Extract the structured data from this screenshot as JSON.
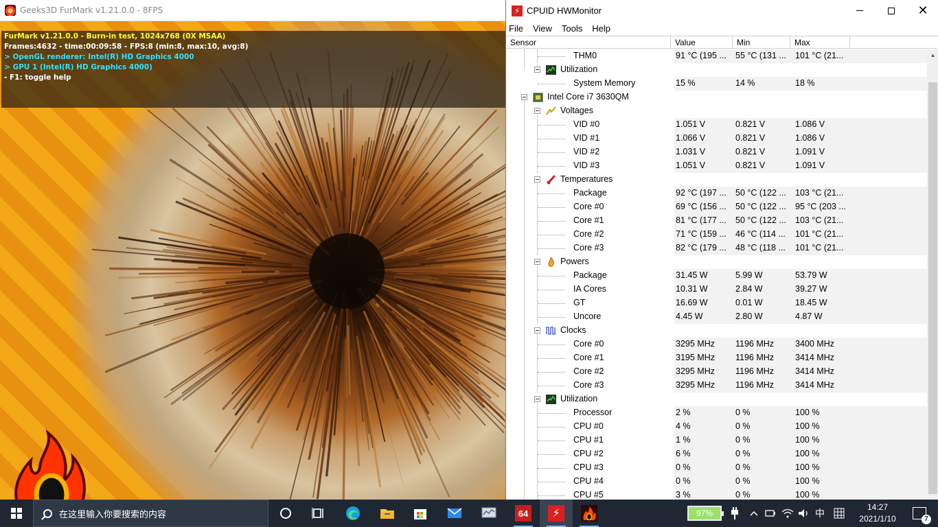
{
  "furmark": {
    "title": "Geeks3D FurMark v1.21.0.0 - 8FPS",
    "info_lines": [
      "FurMark v1.21.0.0 - Burn-in test, 1024x768 (0X MSAA)",
      "Frames:4632 - time:00:09:58 - FPS:8 (min:8, max:10, avg:8)",
      "> OpenGL renderer: Intel(R) HD Graphics 4000",
      "> GPU 1 (Intel(R) HD Graphics 4000)",
      "- F1: toggle help"
    ]
  },
  "hwmonitor": {
    "title": "CPUID HWMonitor",
    "menu": [
      "File",
      "View",
      "Tools",
      "Help"
    ],
    "columns": [
      "Sensor",
      "Value",
      "Min",
      "Max"
    ],
    "rows": [
      {
        "kind": "sensor",
        "name": "THM0",
        "value": "91 °C  (195 ...",
        "min": "55 °C  (131 ...",
        "max": "101 °C  (21..."
      },
      {
        "kind": "group",
        "name": "Utilization",
        "icon": "utilization-icon"
      },
      {
        "kind": "sensor",
        "name": "System Memory",
        "value": "15 %",
        "min": "14 %",
        "max": "18 %"
      },
      {
        "kind": "device",
        "name": "Intel Core i7 3630QM",
        "icon": "cpu-chip-icon"
      },
      {
        "kind": "group",
        "name": "Voltages",
        "icon": "voltage-icon"
      },
      {
        "kind": "sensor",
        "name": "VID #0",
        "value": "1.051 V",
        "min": "0.821 V",
        "max": "1.086 V"
      },
      {
        "kind": "sensor",
        "name": "VID #1",
        "value": "1.066 V",
        "min": "0.821 V",
        "max": "1.086 V"
      },
      {
        "kind": "sensor",
        "name": "VID #2",
        "value": "1.031 V",
        "min": "0.821 V",
        "max": "1.091 V"
      },
      {
        "kind": "sensor",
        "name": "VID #3",
        "value": "1.051 V",
        "min": "0.821 V",
        "max": "1.091 V"
      },
      {
        "kind": "group",
        "name": "Temperatures",
        "icon": "thermometer-icon"
      },
      {
        "kind": "sensor",
        "name": "Package",
        "value": "92 °C  (197 ...",
        "min": "50 °C  (122 ...",
        "max": "103 °C  (21..."
      },
      {
        "kind": "sensor",
        "name": "Core #0",
        "value": "69 °C  (156 ...",
        "min": "50 °C  (122 ...",
        "max": "95 °C  (203 ..."
      },
      {
        "kind": "sensor",
        "name": "Core #1",
        "value": "81 °C  (177 ...",
        "min": "50 °C  (122 ...",
        "max": "103 °C  (21..."
      },
      {
        "kind": "sensor",
        "name": "Core #2",
        "value": "71 °C  (159 ...",
        "min": "46 °C  (114 ...",
        "max": "101 °C  (21..."
      },
      {
        "kind": "sensor",
        "name": "Core #3",
        "value": "82 °C  (179 ...",
        "min": "48 °C  (118 ...",
        "max": "101 °C  (21..."
      },
      {
        "kind": "group",
        "name": "Powers",
        "icon": "power-flame-icon"
      },
      {
        "kind": "sensor",
        "name": "Package",
        "value": "31.45 W",
        "min": "5.99 W",
        "max": "53.79 W"
      },
      {
        "kind": "sensor",
        "name": "IA Cores",
        "value": "10.31 W",
        "min": "2.84 W",
        "max": "39.27 W"
      },
      {
        "kind": "sensor",
        "name": "GT",
        "value": "16.69 W",
        "min": "0.01 W",
        "max": "18.45 W"
      },
      {
        "kind": "sensor",
        "name": "Uncore",
        "value": "4.45 W",
        "min": "2.80 W",
        "max": "4.87 W"
      },
      {
        "kind": "group",
        "name": "Clocks",
        "icon": "clock-wave-icon"
      },
      {
        "kind": "sensor",
        "name": "Core #0",
        "value": "3295 MHz",
        "min": "1196 MHz",
        "max": "3400 MHz"
      },
      {
        "kind": "sensor",
        "name": "Core #1",
        "value": "3195 MHz",
        "min": "1196 MHz",
        "max": "3414 MHz"
      },
      {
        "kind": "sensor",
        "name": "Core #2",
        "value": "3295 MHz",
        "min": "1196 MHz",
        "max": "3414 MHz"
      },
      {
        "kind": "sensor",
        "name": "Core #3",
        "value": "3295 MHz",
        "min": "1196 MHz",
        "max": "3414 MHz"
      },
      {
        "kind": "group",
        "name": "Utilization",
        "icon": "utilization-icon"
      },
      {
        "kind": "sensor",
        "name": "Processor",
        "value": "2 %",
        "min": "0 %",
        "max": "100 %"
      },
      {
        "kind": "sensor",
        "name": "CPU #0",
        "value": "4 %",
        "min": "0 %",
        "max": "100 %"
      },
      {
        "kind": "sensor",
        "name": "CPU #1",
        "value": "1 %",
        "min": "0 %",
        "max": "100 %"
      },
      {
        "kind": "sensor",
        "name": "CPU #2",
        "value": "6 %",
        "min": "0 %",
        "max": "100 %"
      },
      {
        "kind": "sensor",
        "name": "CPU #3",
        "value": "0 %",
        "min": "0 %",
        "max": "100 %"
      },
      {
        "kind": "sensor",
        "name": "CPU #4",
        "value": "0 %",
        "min": "0 %",
        "max": "100 %"
      },
      {
        "kind": "sensor",
        "name": "CPU #5",
        "value": "3 %",
        "min": "0 %",
        "max": "100 %"
      }
    ]
  },
  "taskbar": {
    "search_placeholder": "在这里输入你要搜索的内容",
    "apps": [
      "cortana-icon",
      "task-view-icon",
      "edge-icon",
      "file-explorer-icon",
      "store-icon",
      "mail-icon",
      "hwinfo-icon",
      "aida64-icon",
      "hwmonitor-icon",
      "furmark-icon"
    ],
    "aida_label": "64",
    "battery_percent": "97%",
    "ime": "中",
    "time": "14:27",
    "date": "2021/1/10",
    "notification_count": "7",
    "colors": {
      "background": "#1f2733",
      "battery": "#9be06a",
      "active": "#7ab8f5"
    }
  }
}
